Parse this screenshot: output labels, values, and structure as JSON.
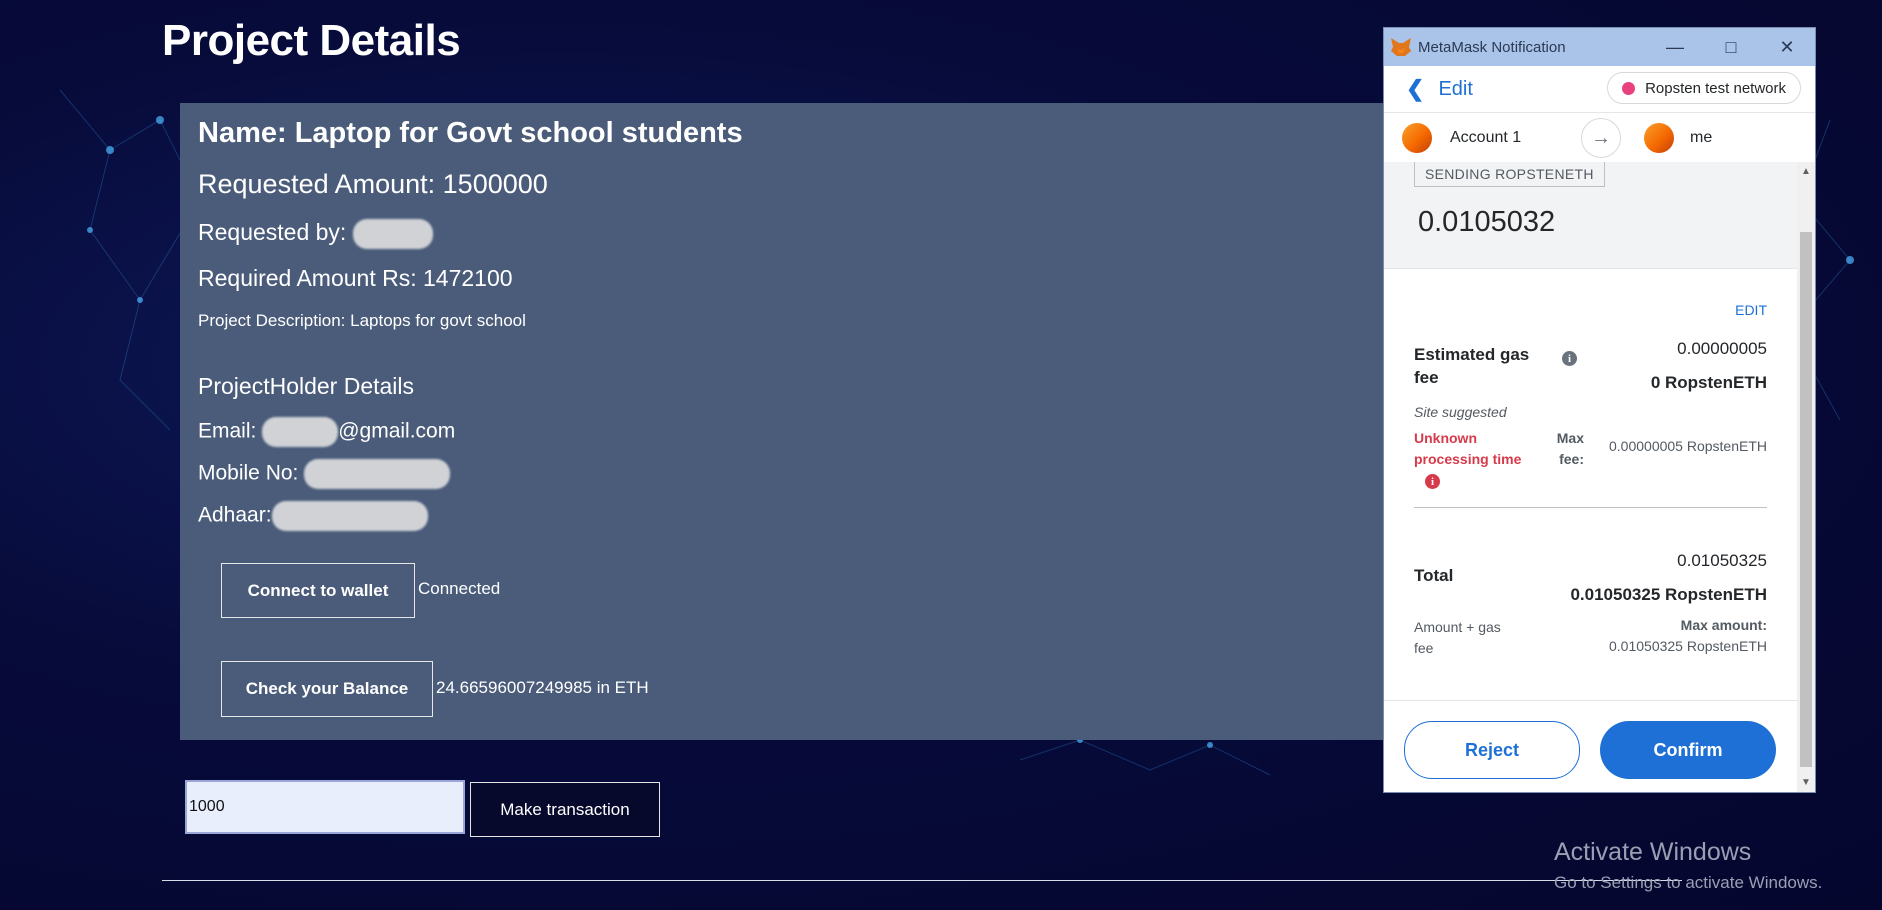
{
  "page": {
    "title": "Project Details"
  },
  "project": {
    "name": "Name: Laptop for Govt school students",
    "requested_amount": "Requested Amount: 1500000",
    "requested_by_label": "Requested by:",
    "required_amount": "Required Amount Rs: 1472100",
    "description": "Project Description: Laptops for govt school"
  },
  "holder": {
    "heading": "ProjectHolder Details",
    "email_label": "Email:",
    "email_suffix": "@gmail.com",
    "mobile_label": "Mobile No:",
    "adhaar_label": "Adhaar:"
  },
  "actions": {
    "connect_label": "Connect to wallet",
    "connect_status": "Connected",
    "balance_label": "Check your Balance",
    "balance_value": "24.66596007249985 in ETH",
    "amount_input_value": "1000",
    "make_tx_label": "Make transaction"
  },
  "watermark": {
    "line1": "Activate Windows",
    "line2": "Go to Settings to activate Windows."
  },
  "metamask": {
    "window_title": "MetaMask Notification",
    "back_label": "Edit",
    "network": "Ropsten test network",
    "network_color": "#e9417e",
    "from_account": "Account 1",
    "to_account": "me",
    "send_tag": "SENDING ROPSTENETH",
    "send_amount": "0.0105032",
    "edit_link": "EDIT",
    "gas_label": "Estimated gas fee",
    "gas_value": "0.00000005",
    "gas_value_bold": "0 RopstenETH",
    "site_suggested": "Site suggested",
    "unknown_time": "Unknown processing time",
    "max_fee_label": "Max fee:",
    "max_fee_value": "0.00000005 RopstenETH",
    "total_label": "Total",
    "total_value": "0.01050325",
    "total_value_bold": "0.01050325 RopstenETH",
    "amount_gas_label": "Amount + gas fee",
    "max_amount_label": "Max amount:",
    "max_amount_value": "0.01050325 RopstenETH",
    "reject_label": "Reject",
    "confirm_label": "Confirm",
    "accent_color": "#1e70d6"
  }
}
